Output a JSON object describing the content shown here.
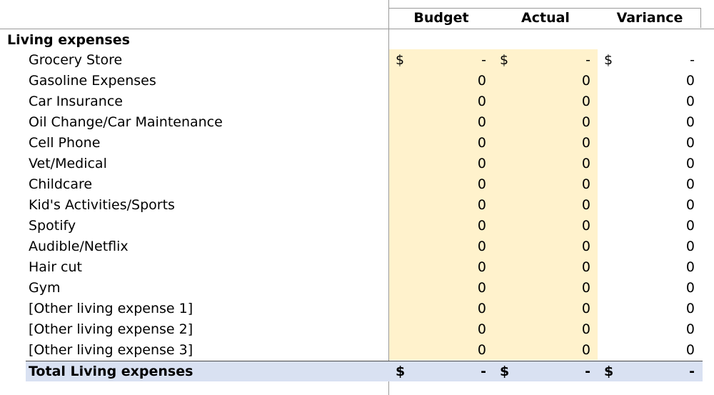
{
  "header": {
    "budget": "Budget",
    "actual": "Actual",
    "variance": "Variance"
  },
  "section": {
    "title": "Living expenses"
  },
  "rows": [
    {
      "label": "Grocery Store",
      "budget": "-",
      "actual": "-",
      "variance": "-",
      "currency": "$"
    },
    {
      "label": "Gasoline Expenses",
      "budget": "0",
      "actual": "0",
      "variance": "0"
    },
    {
      "label": "Car Insurance",
      "budget": "0",
      "actual": "0",
      "variance": "0"
    },
    {
      "label": "Oil Change/Car Maintenance",
      "budget": "0",
      "actual": "0",
      "variance": "0"
    },
    {
      "label": "Cell Phone",
      "budget": "0",
      "actual": "0",
      "variance": "0"
    },
    {
      "label": "Vet/Medical",
      "budget": "0",
      "actual": "0",
      "variance": "0"
    },
    {
      "label": "Childcare",
      "budget": "0",
      "actual": "0",
      "variance": "0"
    },
    {
      "label": "Kid's Activities/Sports",
      "budget": "0",
      "actual": "0",
      "variance": "0"
    },
    {
      "label": "Spotify",
      "budget": "0",
      "actual": "0",
      "variance": "0"
    },
    {
      "label": "Audible/Netflix",
      "budget": "0",
      "actual": "0",
      "variance": "0"
    },
    {
      "label": "Hair cut",
      "budget": "0",
      "actual": "0",
      "variance": "0"
    },
    {
      "label": "Gym",
      "budget": "0",
      "actual": "0",
      "variance": "0"
    },
    {
      "label": "[Other living expense 1]",
      "budget": "0",
      "actual": "0",
      "variance": "0"
    },
    {
      "label": "[Other living expense 2]",
      "budget": "0",
      "actual": "0",
      "variance": "0"
    },
    {
      "label": "[Other living expense 3]",
      "budget": "0",
      "actual": "0",
      "variance": "0"
    }
  ],
  "total": {
    "label": "Total Living expenses",
    "currency": "$",
    "budget": "-",
    "actual": "-",
    "variance": "-"
  },
  "colors": {
    "input_fill": "#fff2cc",
    "total_fill": "#d9e1f2",
    "grid": "#9a9a9a"
  }
}
